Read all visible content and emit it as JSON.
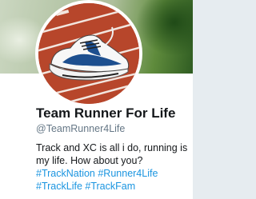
{
  "profile": {
    "name": "Team Runner For Life",
    "handle": "@TeamRunner4Life",
    "bio_line1": "Track and XC is all i do, running is my life.",
    "bio_line2_text": "How about you? ",
    "hashtags": [
      "#TrackNation",
      "#Runner4Life",
      "#TrackLife",
      "#TrackFam"
    ]
  },
  "colors": {
    "link": "#1b95e0",
    "text": "#14171a",
    "muted": "#657786"
  },
  "images": {
    "banner": "blurred-green-field-photo",
    "avatar": "running-shoe-on-track-photo"
  }
}
